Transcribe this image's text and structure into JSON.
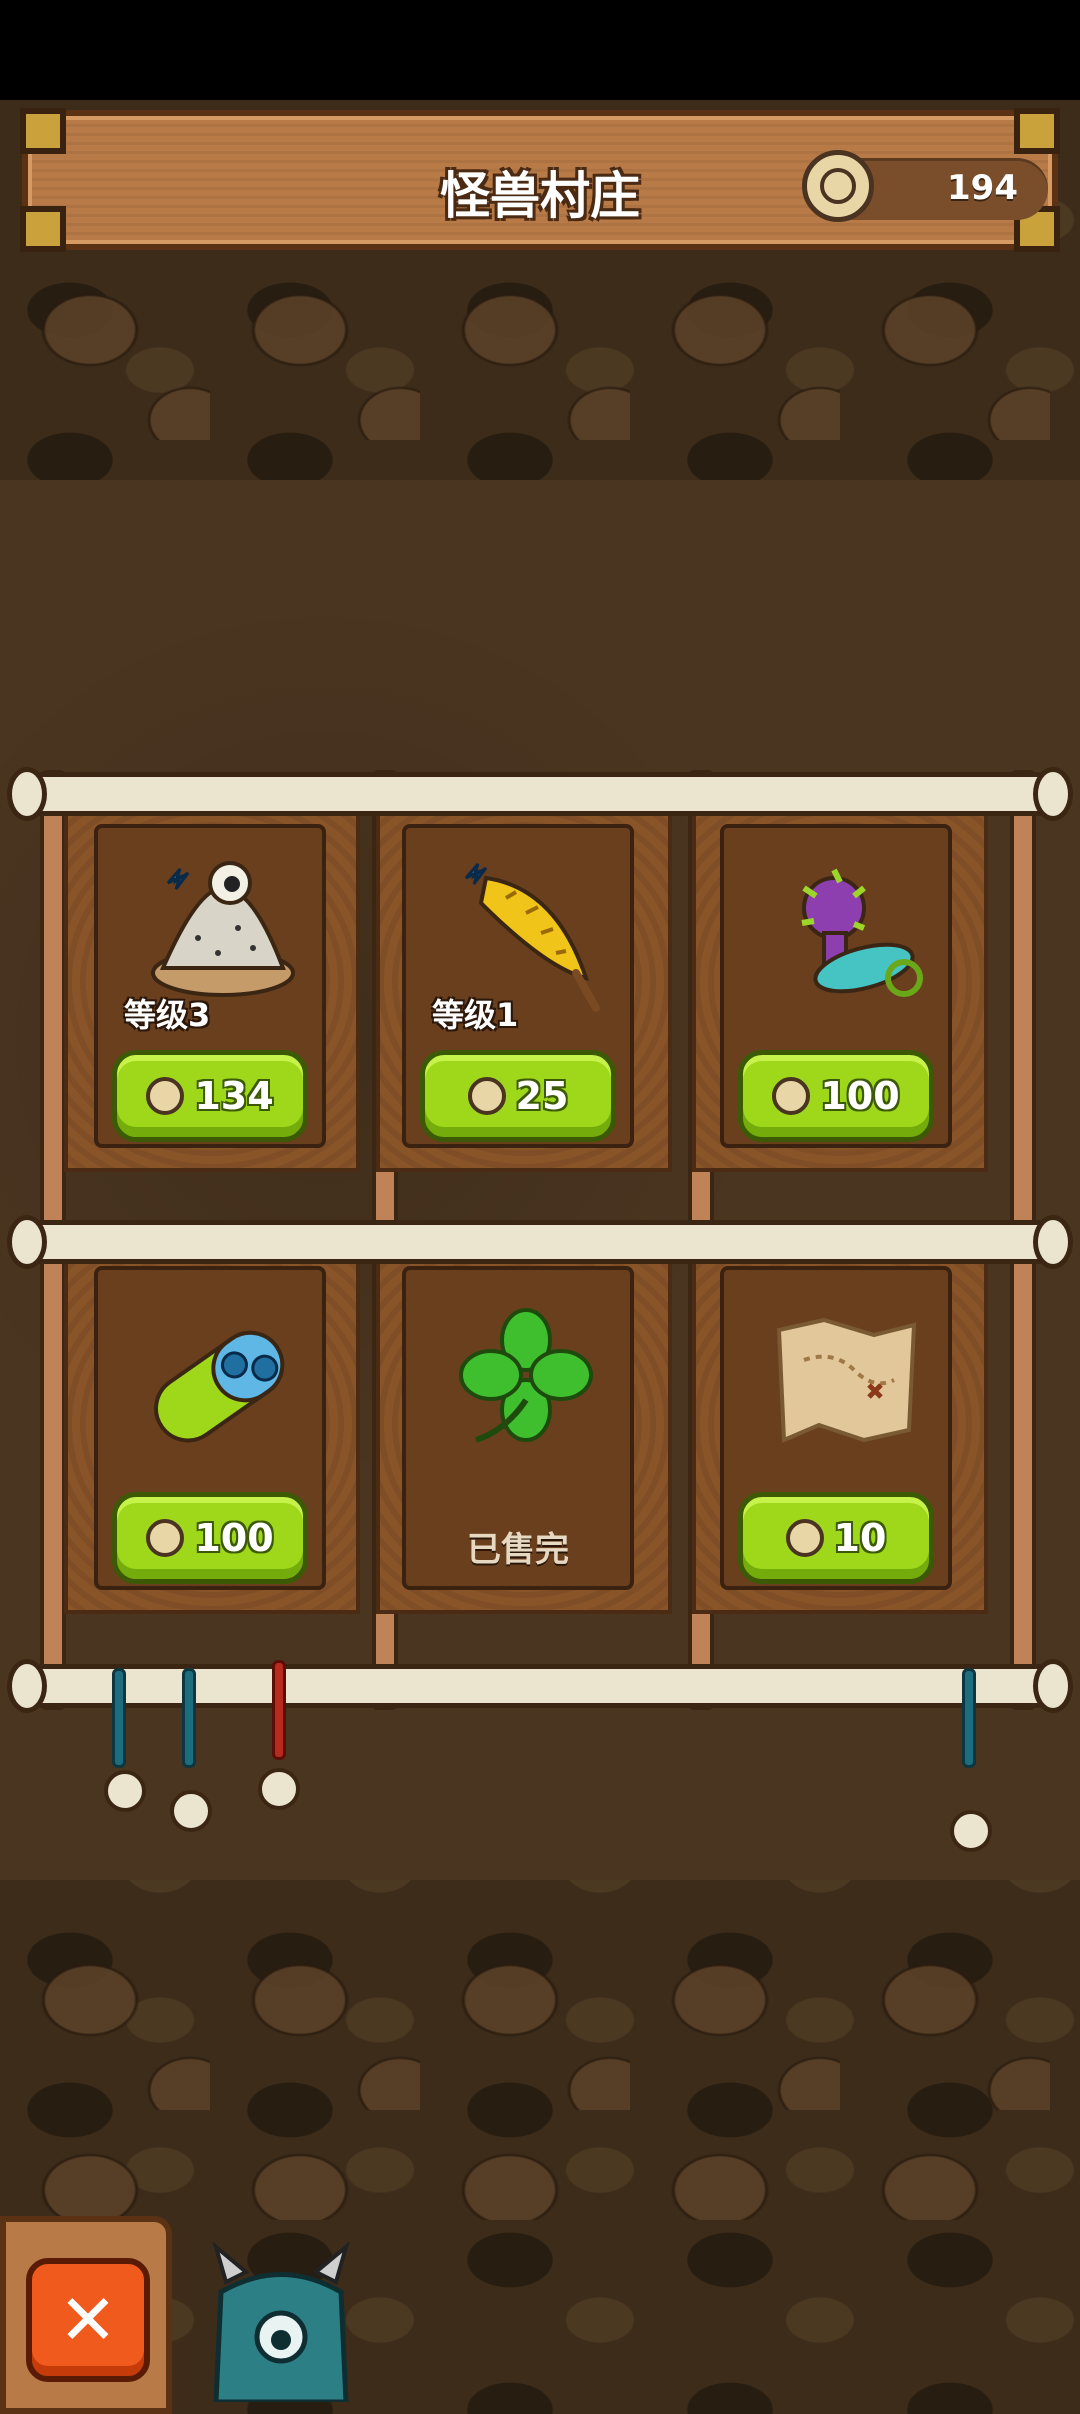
{
  "header": {
    "title": "怪兽村庄",
    "coins": "194"
  },
  "shop": {
    "items": [
      {
        "name": "eyeball-pile",
        "level": "等级3",
        "price": "134",
        "sold_out": false
      },
      {
        "name": "golden-feather-club",
        "level": "等级1",
        "price": "25",
        "sold_out": false
      },
      {
        "name": "spiked-purple-toy",
        "level": "",
        "price": "100",
        "sold_out": false
      },
      {
        "name": "ab-capsule",
        "level": "",
        "price": "100",
        "sold_out": false
      },
      {
        "name": "four-leaf-clover",
        "level": "",
        "price": "",
        "sold_out": true,
        "sold_label": "已售完"
      },
      {
        "name": "treasure-map",
        "level": "",
        "price": "10",
        "sold_out": false
      }
    ]
  },
  "footer": {
    "close_icon": "close-x-icon",
    "monster_icon": "blue-horned-monster-icon"
  },
  "colors": {
    "buy_button": "#9fd81b",
    "close_button": "#f05a1c",
    "board_wood": "#8a5429",
    "header_wood": "#b87a47"
  }
}
